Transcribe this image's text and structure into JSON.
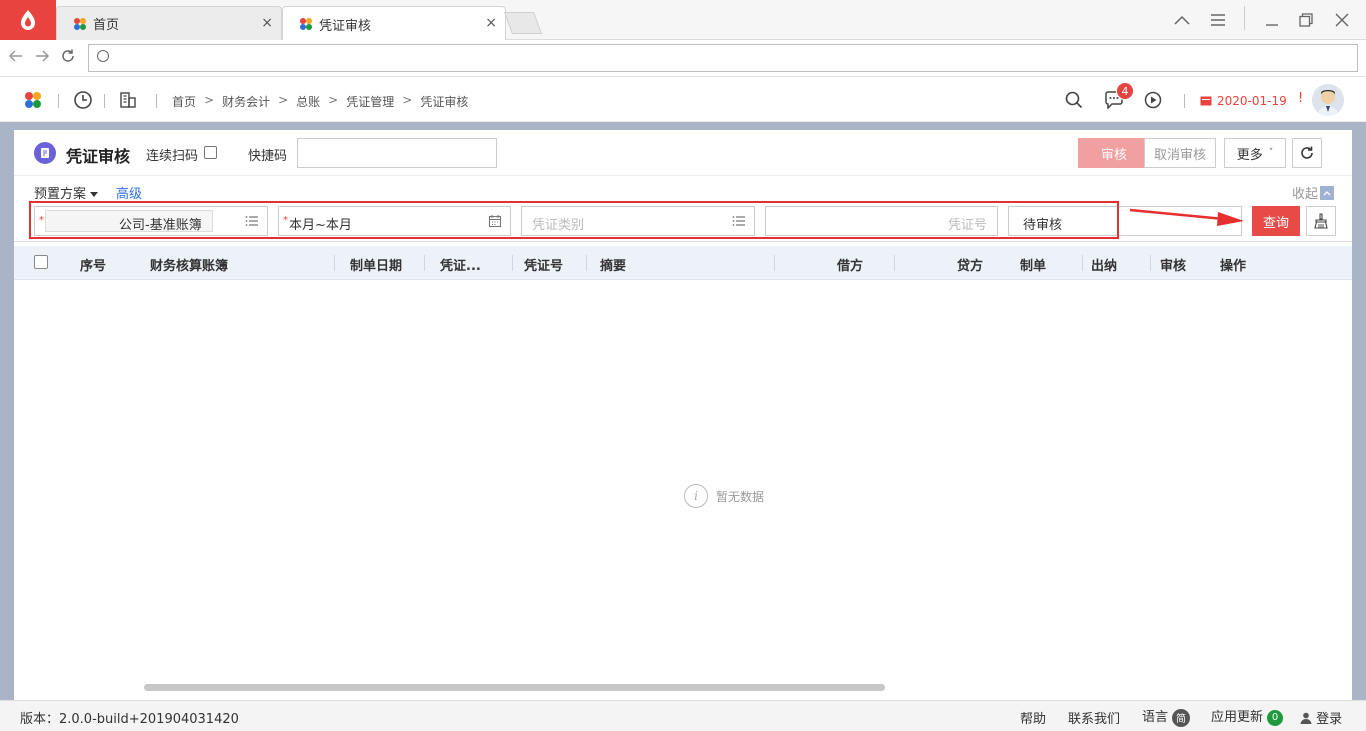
{
  "browser": {
    "tabs": [
      {
        "label": "首页",
        "active": false
      },
      {
        "label": "凭证审核",
        "active": true
      }
    ],
    "close_glyph": "×"
  },
  "header": {
    "breadcrumb": [
      "首页",
      "财务会计",
      "总账",
      "凭证管理",
      "凭证审核"
    ],
    "breadcrumb_sep": ">",
    "message_count": "4",
    "date": "2020-01-19",
    "alert_mark": "!"
  },
  "toolbar": {
    "title": "凭证审核",
    "scan_label": "连续扫码",
    "quick_label": "快捷码",
    "approve": "审核",
    "unapprove": "取消审核",
    "more": "更多",
    "more_caret": "˅"
  },
  "filter": {
    "preset": "预置方案",
    "advanced": "高级",
    "collapse": "收起",
    "required_mark": "*",
    "ledger_value": "公司-基准账簿",
    "period_value": "本月~本月",
    "voucher_type_placeholder": "凭证类别",
    "voucher_no_placeholder": "凭证号",
    "status_value": "待审核",
    "query": "查询"
  },
  "table": {
    "columns": [
      "序号",
      "财务核算账簿",
      "制单日期",
      "凭证...",
      "凭证号",
      "摘要",
      "借方",
      "贷方",
      "制单",
      "出纳",
      "审核",
      "操作"
    ],
    "empty_text": "暂无数据"
  },
  "footer": {
    "version": "版本：2.0.0-build+201904031420",
    "help": "帮助",
    "contact": "联系我们",
    "language": "语言",
    "language_badge": "简",
    "update": "应用更新",
    "update_count": "0",
    "login": "登录"
  },
  "colors": {
    "brand_red": "#e8433f",
    "highlight_border": "#e82f2f",
    "link_blue": "#2f6fd8"
  }
}
